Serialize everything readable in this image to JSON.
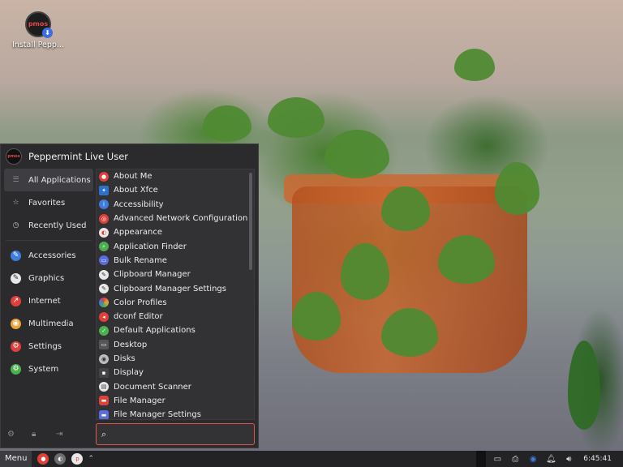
{
  "desktop": {
    "icon_label": "Install Pepp...",
    "icon_logo_text": "pmos",
    "icon_name": "install-peppermint-icon"
  },
  "menu": {
    "user_name": "Peppermint Live User",
    "avatar_text": "pmos",
    "categories": [
      {
        "label": "All Applications",
        "icon": "all-apps-icon",
        "color": "#5a5a5e",
        "active": true
      },
      {
        "label": "Favorites",
        "icon": "star-icon",
        "color": "#5a5a5e"
      },
      {
        "label": "Recently Used",
        "icon": "clock-icon",
        "color": "#5a5a5e"
      },
      {
        "label": "Accessories",
        "icon": "accessories-icon",
        "color": "#3f7ddc"
      },
      {
        "label": "Graphics",
        "icon": "graphics-icon",
        "color": "#e8e8e8"
      },
      {
        "label": "Internet",
        "icon": "internet-icon",
        "color": "#e0403a"
      },
      {
        "label": "Multimedia",
        "icon": "multimedia-icon",
        "color": "#e8a33a"
      },
      {
        "label": "Settings",
        "icon": "settings-icon",
        "color": "#e0403a"
      },
      {
        "label": "System",
        "icon": "system-icon",
        "color": "#4caf50"
      }
    ],
    "apps": [
      {
        "label": "About Me",
        "icon": "about-me-icon",
        "color": "#e0403a"
      },
      {
        "label": "About Xfce",
        "icon": "xfce-icon",
        "color": "#2e6fd0"
      },
      {
        "label": "Accessibility",
        "icon": "accessibility-icon",
        "color": "#3f7ddc"
      },
      {
        "label": "Advanced Network Configuration",
        "icon": "network-icon",
        "color": "#e0403a"
      },
      {
        "label": "Appearance",
        "icon": "appearance-icon",
        "color": "#e8e8e8"
      },
      {
        "label": "Application Finder",
        "icon": "app-finder-icon",
        "color": "#4caf50"
      },
      {
        "label": "Bulk Rename",
        "icon": "bulk-rename-icon",
        "color": "#5b6ce0"
      },
      {
        "label": "Clipboard Manager",
        "icon": "clipboard-icon",
        "color": "#e8e8e8"
      },
      {
        "label": "Clipboard Manager Settings",
        "icon": "clipboard-settings-icon",
        "color": "#e8e8e8"
      },
      {
        "label": "Color Profiles",
        "icon": "color-profiles-icon",
        "color": "#e8a33a"
      },
      {
        "label": "dconf Editor",
        "icon": "dconf-icon",
        "color": "#e0403a"
      },
      {
        "label": "Default Applications",
        "icon": "default-apps-icon",
        "color": "#4caf50"
      },
      {
        "label": "Desktop",
        "icon": "desktop-icon",
        "color": "#555559"
      },
      {
        "label": "Disks",
        "icon": "disks-icon",
        "color": "#bdbdbd"
      },
      {
        "label": "Display",
        "icon": "display-icon",
        "color": "#444448"
      },
      {
        "label": "Document Scanner",
        "icon": "scanner-icon",
        "color": "#e8e8e8"
      },
      {
        "label": "File Manager",
        "icon": "file-manager-icon",
        "color": "#e0403a"
      },
      {
        "label": "File Manager Settings",
        "icon": "file-manager-settings-icon",
        "color": "#5b6ce0"
      }
    ],
    "search": {
      "value": "",
      "placeholder": ""
    }
  },
  "taskbar": {
    "menu_label": "Menu",
    "clock": "6:45:41",
    "launchers": [
      {
        "icon": "red-app-icon",
        "color": "#e0403a"
      },
      {
        "icon": "grey-app-icon",
        "color": "#6b6b70"
      },
      {
        "icon": "pmos-app-icon",
        "color": "#e8e8e8"
      }
    ],
    "tray": [
      "window-icon",
      "device-icon",
      "network-icon",
      "bell-icon",
      "volume-icon"
    ]
  }
}
